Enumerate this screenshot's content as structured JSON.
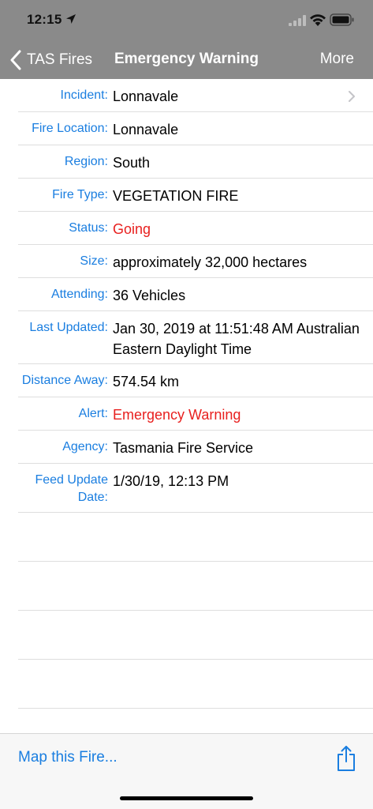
{
  "status_bar": {
    "time": "12:15"
  },
  "nav": {
    "back_label": "TAS Fires",
    "title": "Emergency Warning",
    "more_label": "More"
  },
  "details": [
    {
      "label": "Incident:",
      "value": "Lonnavale",
      "color": "#000000",
      "disclosure": true
    },
    {
      "label": "Fire Location:",
      "value": "Lonnavale",
      "color": "#000000"
    },
    {
      "label": "Region:",
      "value": "South",
      "color": "#000000"
    },
    {
      "label": "Fire Type:",
      "value": "VEGETATION FIRE",
      "color": "#000000"
    },
    {
      "label": "Status:",
      "value": "Going",
      "color": "#e8201f"
    },
    {
      "label": "Size:",
      "value": "approximately 32,000 hectares",
      "color": "#000000"
    },
    {
      "label": "Attending:",
      "value": "36 Vehicles",
      "color": "#000000"
    },
    {
      "label": "Last Updated:",
      "value": "Jan 30, 2019 at 11:51:48 AM Australian Eastern Daylight Time",
      "color": "#000000"
    },
    {
      "label": "Distance Away:",
      "value": "574.54 km",
      "color": "#000000"
    },
    {
      "label": "Alert:",
      "value": "Emergency Warning",
      "color": "#e8201f"
    },
    {
      "label": "Agency:",
      "value": "Tasmania Fire Service",
      "color": "#000000"
    },
    {
      "label": "Feed Update Date:",
      "value": "1/30/19, 12:13 PM",
      "color": "#000000"
    }
  ],
  "toolbar": {
    "map_label": "Map this Fire...",
    "share_icon": "share-icon"
  },
  "colors": {
    "accent": "#1a7ee0",
    "alert": "#e8201f",
    "nav_background": "#8a8a8a"
  }
}
